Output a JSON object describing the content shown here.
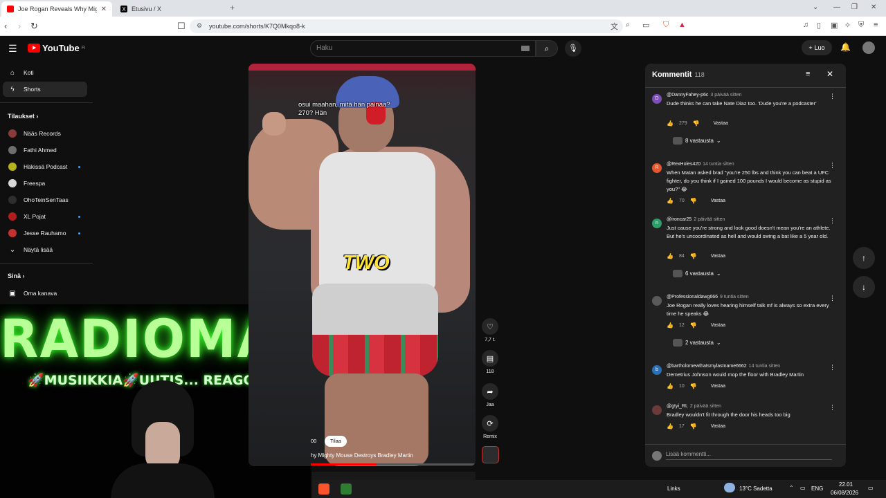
{
  "browser": {
    "tabs": [
      {
        "title": "Joe Rogan Reveals Why Migh",
        "active": true
      },
      {
        "title": "Etusivu / X",
        "active": false
      }
    ],
    "url": "youtube.com/shorts/K7Q0Mkqo8-k"
  },
  "header": {
    "logo_text": "YouTube",
    "logo_region": "FI",
    "search_placeholder": "Haku",
    "create_label": "Luo"
  },
  "sidebar": {
    "main_items": [
      {
        "label": "Koti",
        "icon": "home-icon"
      },
      {
        "label": "Shorts",
        "icon": "shorts-icon",
        "active": true
      }
    ],
    "subscriptions_heading": "Tilaukset",
    "subscriptions": [
      {
        "label": "Nääs Records",
        "color": "#8a3b3b",
        "dot": false
      },
      {
        "label": "Fathi Ahmed",
        "color": "#6e6e6e",
        "dot": false
      },
      {
        "label": "Häkissä Podcast",
        "color": "#b8b21a",
        "dot": true
      },
      {
        "label": "Freespa",
        "color": "#d9d9d9",
        "dot": false
      },
      {
        "label": "OhoTeinSenTaas",
        "color": "#2e2e2e",
        "dot": false
      },
      {
        "label": "XL Pojat",
        "color": "#b21e1e",
        "dot": true
      },
      {
        "label": "Jesse Rauhamo",
        "color": "#c4322f",
        "dot": true
      }
    ],
    "show_more": "Näytä lisää",
    "you_heading": "Sinä",
    "your_channel": "Oma kanava"
  },
  "overlay": {
    "title": "RADIOMANE",
    "tagline": "🚀MUSIIKKIA🚀UUTIS... REAGOINTIA!🚀"
  },
  "short": {
    "caption": "osui maahan, mitä hän painaa?\n270?  Hän",
    "big_text": "TWO",
    "subscribe_label": "Tilaa",
    "subscriber_fragment": "00",
    "title": "hy Mighty Mouse Destroys Bradley Martin",
    "progress": 0.4,
    "like_count": "7,7 t.",
    "comment_count": "118",
    "share_label": "Jaa",
    "remix_label": "Remix"
  },
  "comments": {
    "heading": "Kommentit",
    "count": "118",
    "add_placeholder": "Lisää kommentti...",
    "reply_label": "Vastaa",
    "items": [
      {
        "user": "@DannyFahey-p6c",
        "ago": "3 päivää sitten",
        "initial": "D",
        "avatar_color": "#7b4fb7",
        "text": "Dude thinks he can take Nate Diaz too. 'Dude you're a podcaster'",
        "likes": "279",
        "replies": "8 vastausta"
      },
      {
        "user": "@RexHoles420",
        "ago": "14 tuntia sitten",
        "initial": "R",
        "avatar_color": "#e4572e",
        "text": "When Matan asked brad \"you're 250 lbs and think you can beat a UFC fighter, do you think if I gained 100 pounds I would become as stupid as you?\" 😂",
        "likes": "70",
        "replies": ""
      },
      {
        "user": "@ironcar25",
        "ago": "2 päivää sitten",
        "initial": "n",
        "avatar_color": "#2e9e6b",
        "text": "Just cause you're strong and look good doesn't mean you're an athlete. But he's uncoordinated as hell and would swing a bat like a 5 year old.",
        "likes": "84",
        "replies": "6 vastausta"
      },
      {
        "user": "@Professionaldawg666",
        "ago": "9 tuntia sitten",
        "initial": "",
        "avatar_color": "#5a5a5a",
        "text": "Joe Rogan really loves hearing himself talk mf is always so extra every time he speaks 😂",
        "likes": "12",
        "replies": "2 vastausta"
      },
      {
        "user": "@bartholomewthatsmylastname6662",
        "ago": "14 tuntia sitten",
        "initial": "b",
        "avatar_color": "#2a6fb5",
        "text": "Demetrius Johnson would mop the floor with Bradley Martin",
        "likes": "10",
        "replies": ""
      },
      {
        "user": "@gtyi_RL",
        "ago": "2 päivää sitten",
        "initial": "",
        "avatar_color": "#6b3b3b",
        "text": "Bradley wouldn't fit through the door his heads too big",
        "likes": "17",
        "replies": ""
      }
    ]
  },
  "taskbar": {
    "links_label": "Links",
    "weather": "13°C  Sadetta",
    "lang": "ENG",
    "time": "22.01",
    "date": "06/08/2026"
  }
}
